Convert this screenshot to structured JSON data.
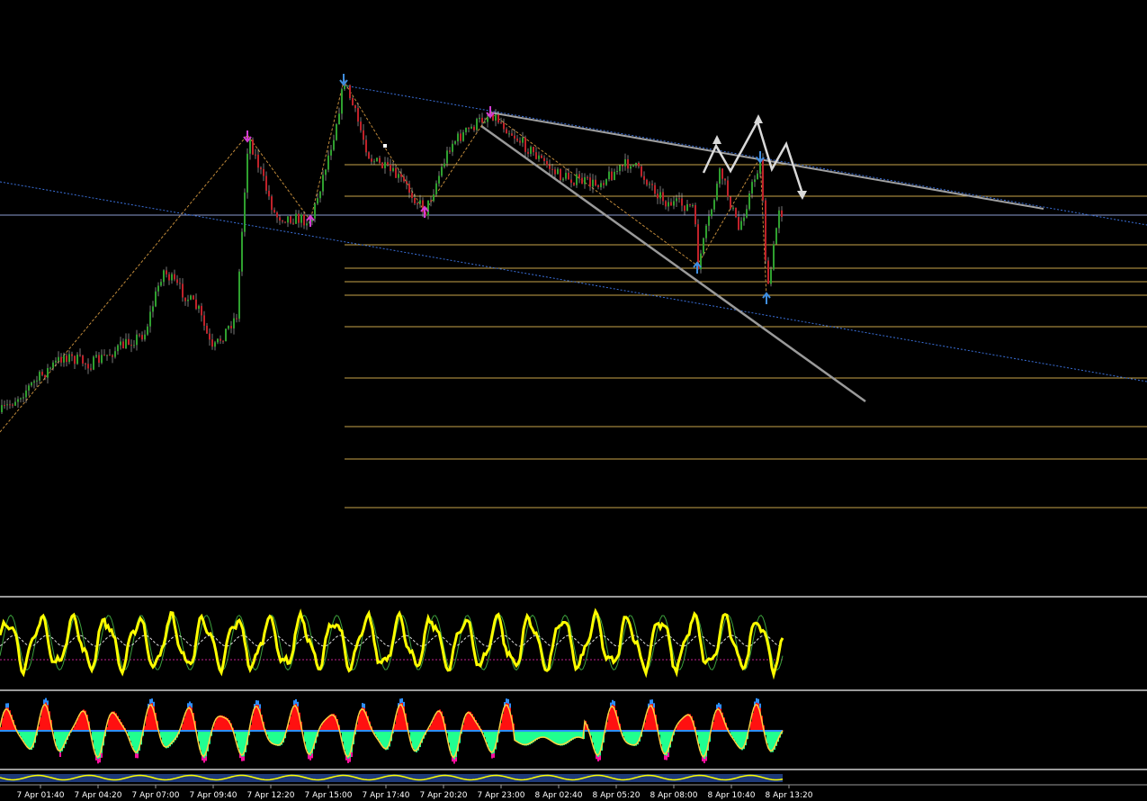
{
  "chart_data": {
    "type": "candlestick",
    "title": "",
    "colors": {
      "background": "#000000",
      "bull": "#2fa02f",
      "bear": "#c0222a",
      "wick": "#c8c8c8",
      "trend_dotted": "#3a6fd8",
      "fib_level": "#c9a44a",
      "zigzag": "#c08a3a",
      "arrow_magenta": "#d33cd3",
      "arrow_blue": "#3f8ee0",
      "projection": "#d9d9d9",
      "channel_line": "#9a9a9a",
      "osc_main": "#ffff00",
      "osc_signal": "#3ca03c",
      "hist_positive": "#ff1010",
      "hist_negative": "#20ff90",
      "hist_extreme_pos": "#2d8fff",
      "hist_extreme_neg": "#ff10a0"
    },
    "x_ticks": [
      "7 Apr 01:40",
      "7 Apr 04:20",
      "7 Apr 07:00",
      "7 Apr 09:40",
      "7 Apr 12:20",
      "7 Apr 15:00",
      "7 Apr 17:40",
      "7 Apr 20:20",
      "7 Apr 23:00",
      "8 Apr 02:40",
      "8 Apr 05:20",
      "8 Apr 08:00",
      "8 Apr 10:40",
      "8 Apr 13:20"
    ],
    "price_path": [
      [
        0,
        458
      ],
      [
        70,
        395
      ],
      [
        100,
        405
      ],
      [
        160,
        370
      ],
      [
        180,
        300
      ],
      [
        220,
        345
      ],
      [
        235,
        390
      ],
      [
        262,
        350
      ],
      [
        275,
        150
      ],
      [
        305,
        240
      ],
      [
        345,
        245
      ],
      [
        370,
        150
      ],
      [
        382,
        90
      ],
      [
        410,
        175
      ],
      [
        445,
        200
      ],
      [
        472,
        235
      ],
      [
        500,
        160
      ],
      [
        545,
        125
      ],
      [
        575,
        155
      ],
      [
        620,
        195
      ],
      [
        660,
        205
      ],
      [
        700,
        180
      ],
      [
        740,
        225
      ],
      [
        770,
        230
      ],
      [
        775,
        295
      ],
      [
        800,
        190
      ],
      [
        820,
        255
      ],
      [
        845,
        175
      ],
      [
        852,
        330
      ],
      [
        865,
        230
      ],
      [
        870,
        240
      ]
    ],
    "oscillator_cycles": 24,
    "histogram_cycles": 22
  }
}
